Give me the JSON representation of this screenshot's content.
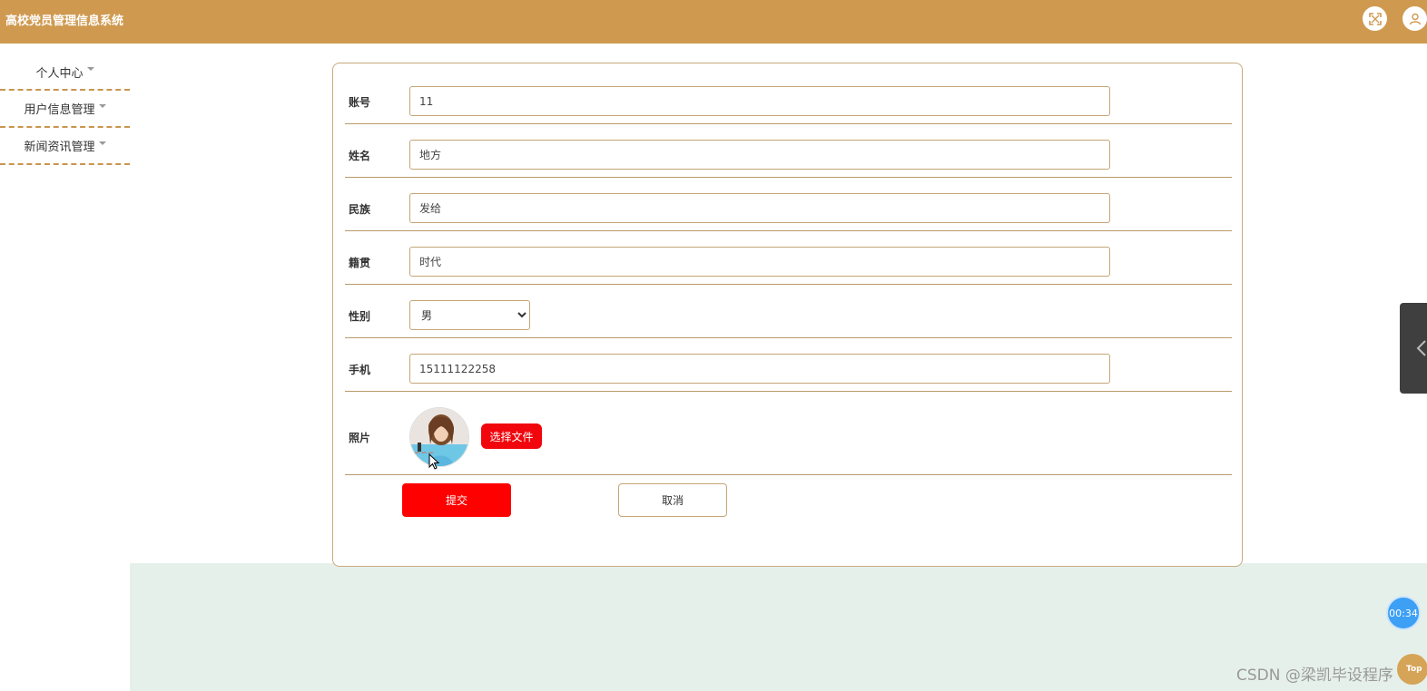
{
  "header": {
    "title": "高校党员管理信息系统",
    "bg_color": "#cf9a50",
    "fullscreen_icon": "fullscreen-icon",
    "user_icon": "user-icon"
  },
  "sidebar": {
    "items": [
      {
        "label": "个人中心"
      },
      {
        "label": "用户信息管理"
      },
      {
        "label": "新闻资讯管理"
      }
    ]
  },
  "form": {
    "fields": {
      "account": {
        "label": "账号",
        "value": "11"
      },
      "name": {
        "label": "姓名",
        "value": "地方"
      },
      "ethnicity": {
        "label": "民族",
        "value": "发给"
      },
      "hometown": {
        "label": "籍贯",
        "value": "时代"
      },
      "gender": {
        "label": "性别",
        "value": "男"
      },
      "phone": {
        "label": "手机",
        "value": "15111122258"
      },
      "photo": {
        "label": "照片",
        "button_label": "选择文件"
      }
    },
    "submit_label": "提交",
    "cancel_label": "取消",
    "accent_color": "#ff0000"
  },
  "widgets": {
    "timer_text": "00:34",
    "top_text": "Top"
  },
  "watermark": "CSDN @梁凯毕设程序"
}
